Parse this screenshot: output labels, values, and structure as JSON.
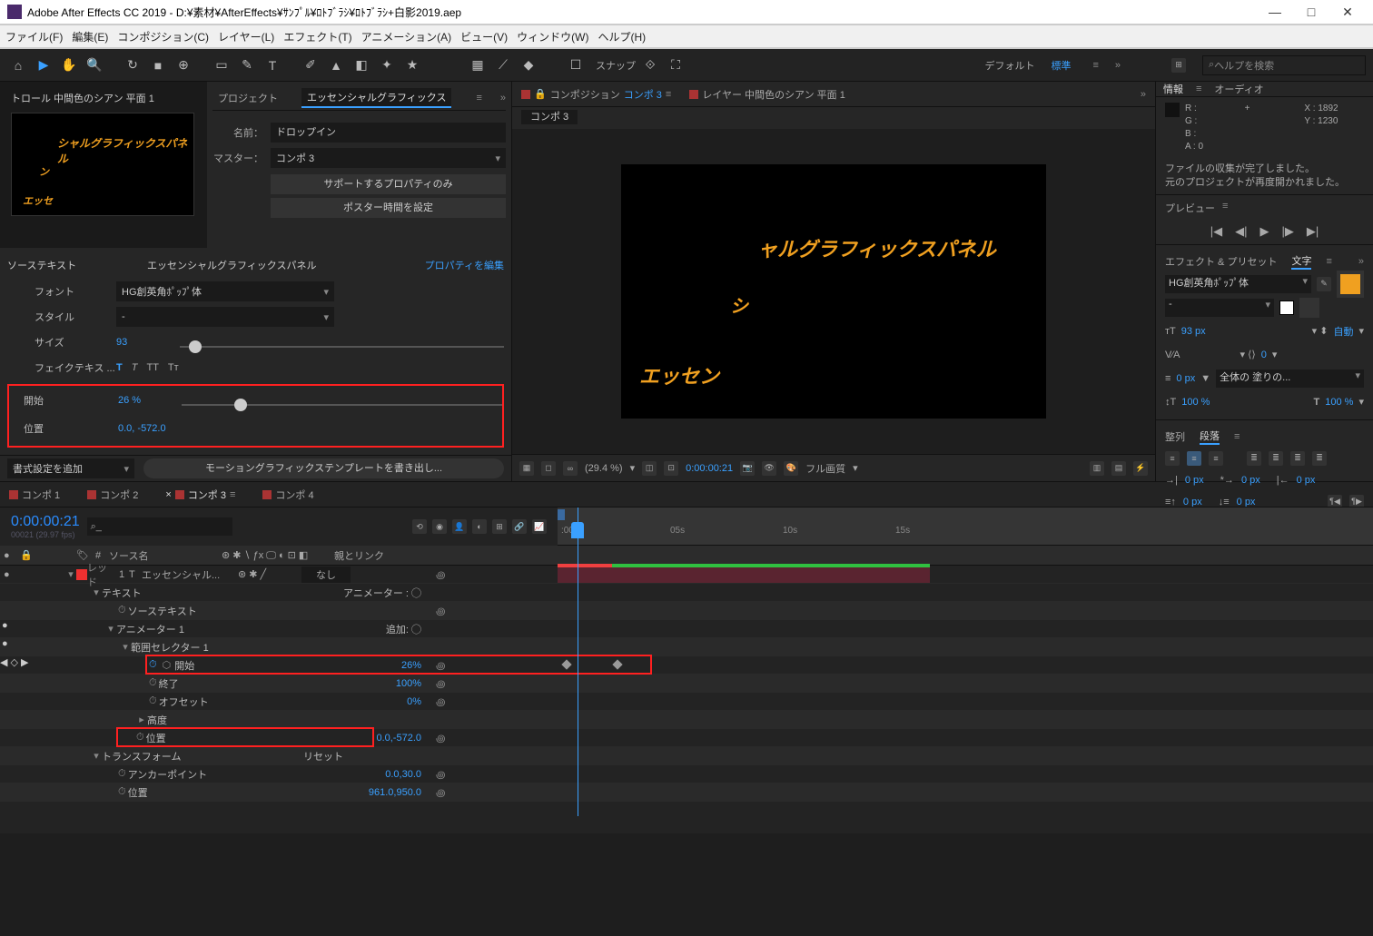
{
  "title_bar": {
    "title": "Adobe After Effects CC 2019 - D:¥素材¥AfterEffects¥ｻﾝﾌﾟﾙ¥ﾛﾄﾌﾞﾗｼ¥ﾛﾄﾌﾞﾗｼ+白影2019.aep"
  },
  "menu": {
    "file": "ファイル(F)",
    "edit": "編集(E)",
    "comp": "コンポジション(C)",
    "layer": "レイヤー(L)",
    "effect": "エフェクト(T)",
    "anim": "アニメーション(A)",
    "view": "ビュー(V)",
    "window": "ウィンドウ(W)",
    "help": "ヘルプ(H)"
  },
  "toolbar": {
    "snap": "スナップ",
    "default": "デフォルト",
    "standard": "標準",
    "search_ph": "ヘルプを検索"
  },
  "left_header": "トロール 中間色のシアン 平面 1",
  "egp": {
    "tab_project": "プロジェクト",
    "tab_egp": "エッセンシャルグラフィックス",
    "name_lbl": "名前：",
    "name_val": "ドロップイン",
    "master_lbl": "マスター：",
    "master_val": "コンポ 3",
    "support_btn": "サポートするプロパティのみ",
    "poster_btn": "ポスター時間を設定",
    "src_text": "ソーステキスト",
    "panel_title": "エッセンシャルグラフィックスパネル",
    "edit_props": "プロパティを編集",
    "font_lbl": "フォント",
    "font_val": "HG創英角ﾎﾟｯﾌﾟ体",
    "style_lbl": "スタイル",
    "style_val": "-",
    "size_lbl": "サイズ",
    "size_val": "93",
    "fake_lbl": "フェイクテキス ...",
    "start_lbl": "開始",
    "start_val": "26 %",
    "pos_lbl": "位置",
    "pos_val": "0.0, -572.0",
    "format_add": "書式設定を追加",
    "export_btn": "モーショングラフィックステンプレートを書き出し..."
  },
  "comp_panel": {
    "tab_comp_pre": "コンポジション",
    "comp_link": "コンポ 3",
    "tab_layer": "レイヤー 中間色のシアン 平面 1",
    "crumb": "コンポ 3",
    "zoom": "(29.4 %)",
    "time": "0:00:00:21",
    "quality": "フル画質"
  },
  "info": {
    "tab_info": "情報",
    "tab_audio": "オーディオ",
    "r": "R :",
    "g": "G :",
    "b": "B :",
    "a": "A : 0",
    "x": "X : 1892",
    "y": "Y : 1230",
    "msg1": "ファイルの収集が完了しました。",
    "msg2": "元のプロジェクトが再度開かれました。"
  },
  "preview": {
    "header": "プレビュー"
  },
  "char": {
    "tab_eff": "エフェクト & プリセット",
    "tab_char": "文字",
    "font": "HG創英角ﾎﾟｯﾌﾟ体",
    "style": "-",
    "size": "93 px",
    "leading": "自動",
    "tracking": "0",
    "stroke_w": "0 px",
    "stroke_opt": "全体の 塗りの...",
    "scale1": "100 %",
    "scale2": "100 %"
  },
  "align": {
    "tab_align": "整列",
    "tab_para": "段落"
  },
  "para": {
    "indent_l": "0 px",
    "indent_r": "0 px",
    "indent_f": "0 px",
    "space_b": "0 px",
    "space_a": "0 px"
  },
  "timeline": {
    "tabs": {
      "c1": "コンポ 1",
      "c2": "コンポ 2",
      "c3": "コンポ 3",
      "c4": "コンポ 4"
    },
    "timecode": "0:00:00:21",
    "fps": "00021 (29.97 fps)",
    "ruler": {
      "t0": ":00f",
      "t5": "05s",
      "t10": "10s",
      "t15": "15s"
    },
    "cols": {
      "source": "ソース名",
      "parent": "親とリンク",
      "num": "#"
    },
    "layer1": {
      "label": "レッド",
      "num": "1",
      "type": "T",
      "name": "エッセンシャル...",
      "parent": "なし"
    },
    "rows": {
      "text": "テキスト",
      "animator": "アニメーター : ◯",
      "src": "ソーステキスト",
      "anim1": "アニメーター 1",
      "add": "追加: ◯",
      "range": "範囲セレクター 1",
      "start": "開始",
      "start_v": "26%",
      "end": "終了",
      "end_v": "100%",
      "offset": "オフセット",
      "offset_v": "0%",
      "adv": "高度",
      "pos": "位置",
      "pos_v": "0.0,-572.0",
      "transform": "トランスフォーム",
      "reset": "リセット",
      "anchor": "アンカーポイント",
      "anchor_v": "0.0,30.0",
      "tpos": "位置",
      "tpos_v": "961.0,950.0"
    }
  }
}
